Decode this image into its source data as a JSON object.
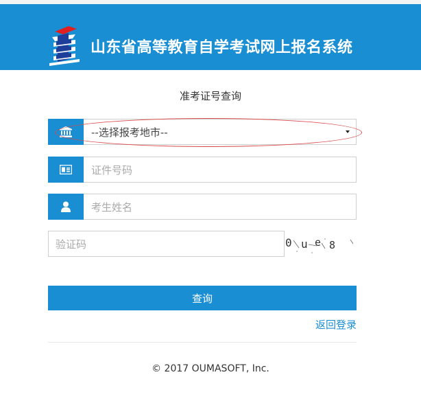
{
  "header": {
    "site_title": "山东省高等教育自学考试网上报名系统",
    "logo_icon": "exam-system-logo-icon"
  },
  "page_title": "准考证号查询",
  "form": {
    "city_select": {
      "icon": "bank-icon",
      "selected_value": "--选择报考地市--"
    },
    "id_number": {
      "icon": "id-card-icon",
      "placeholder": "证件号码"
    },
    "name": {
      "icon": "user-icon",
      "placeholder": "考生姓名"
    },
    "captcha": {
      "placeholder": "验证码",
      "image_text": "0 u e 8"
    },
    "submit_label": "查询",
    "back_link": "返回登录"
  },
  "footer": {
    "copyright": "© 2017 OUMASOFT, Inc."
  },
  "colors": {
    "primary": "#1a8ed2",
    "annotation": "#d94a4a"
  }
}
